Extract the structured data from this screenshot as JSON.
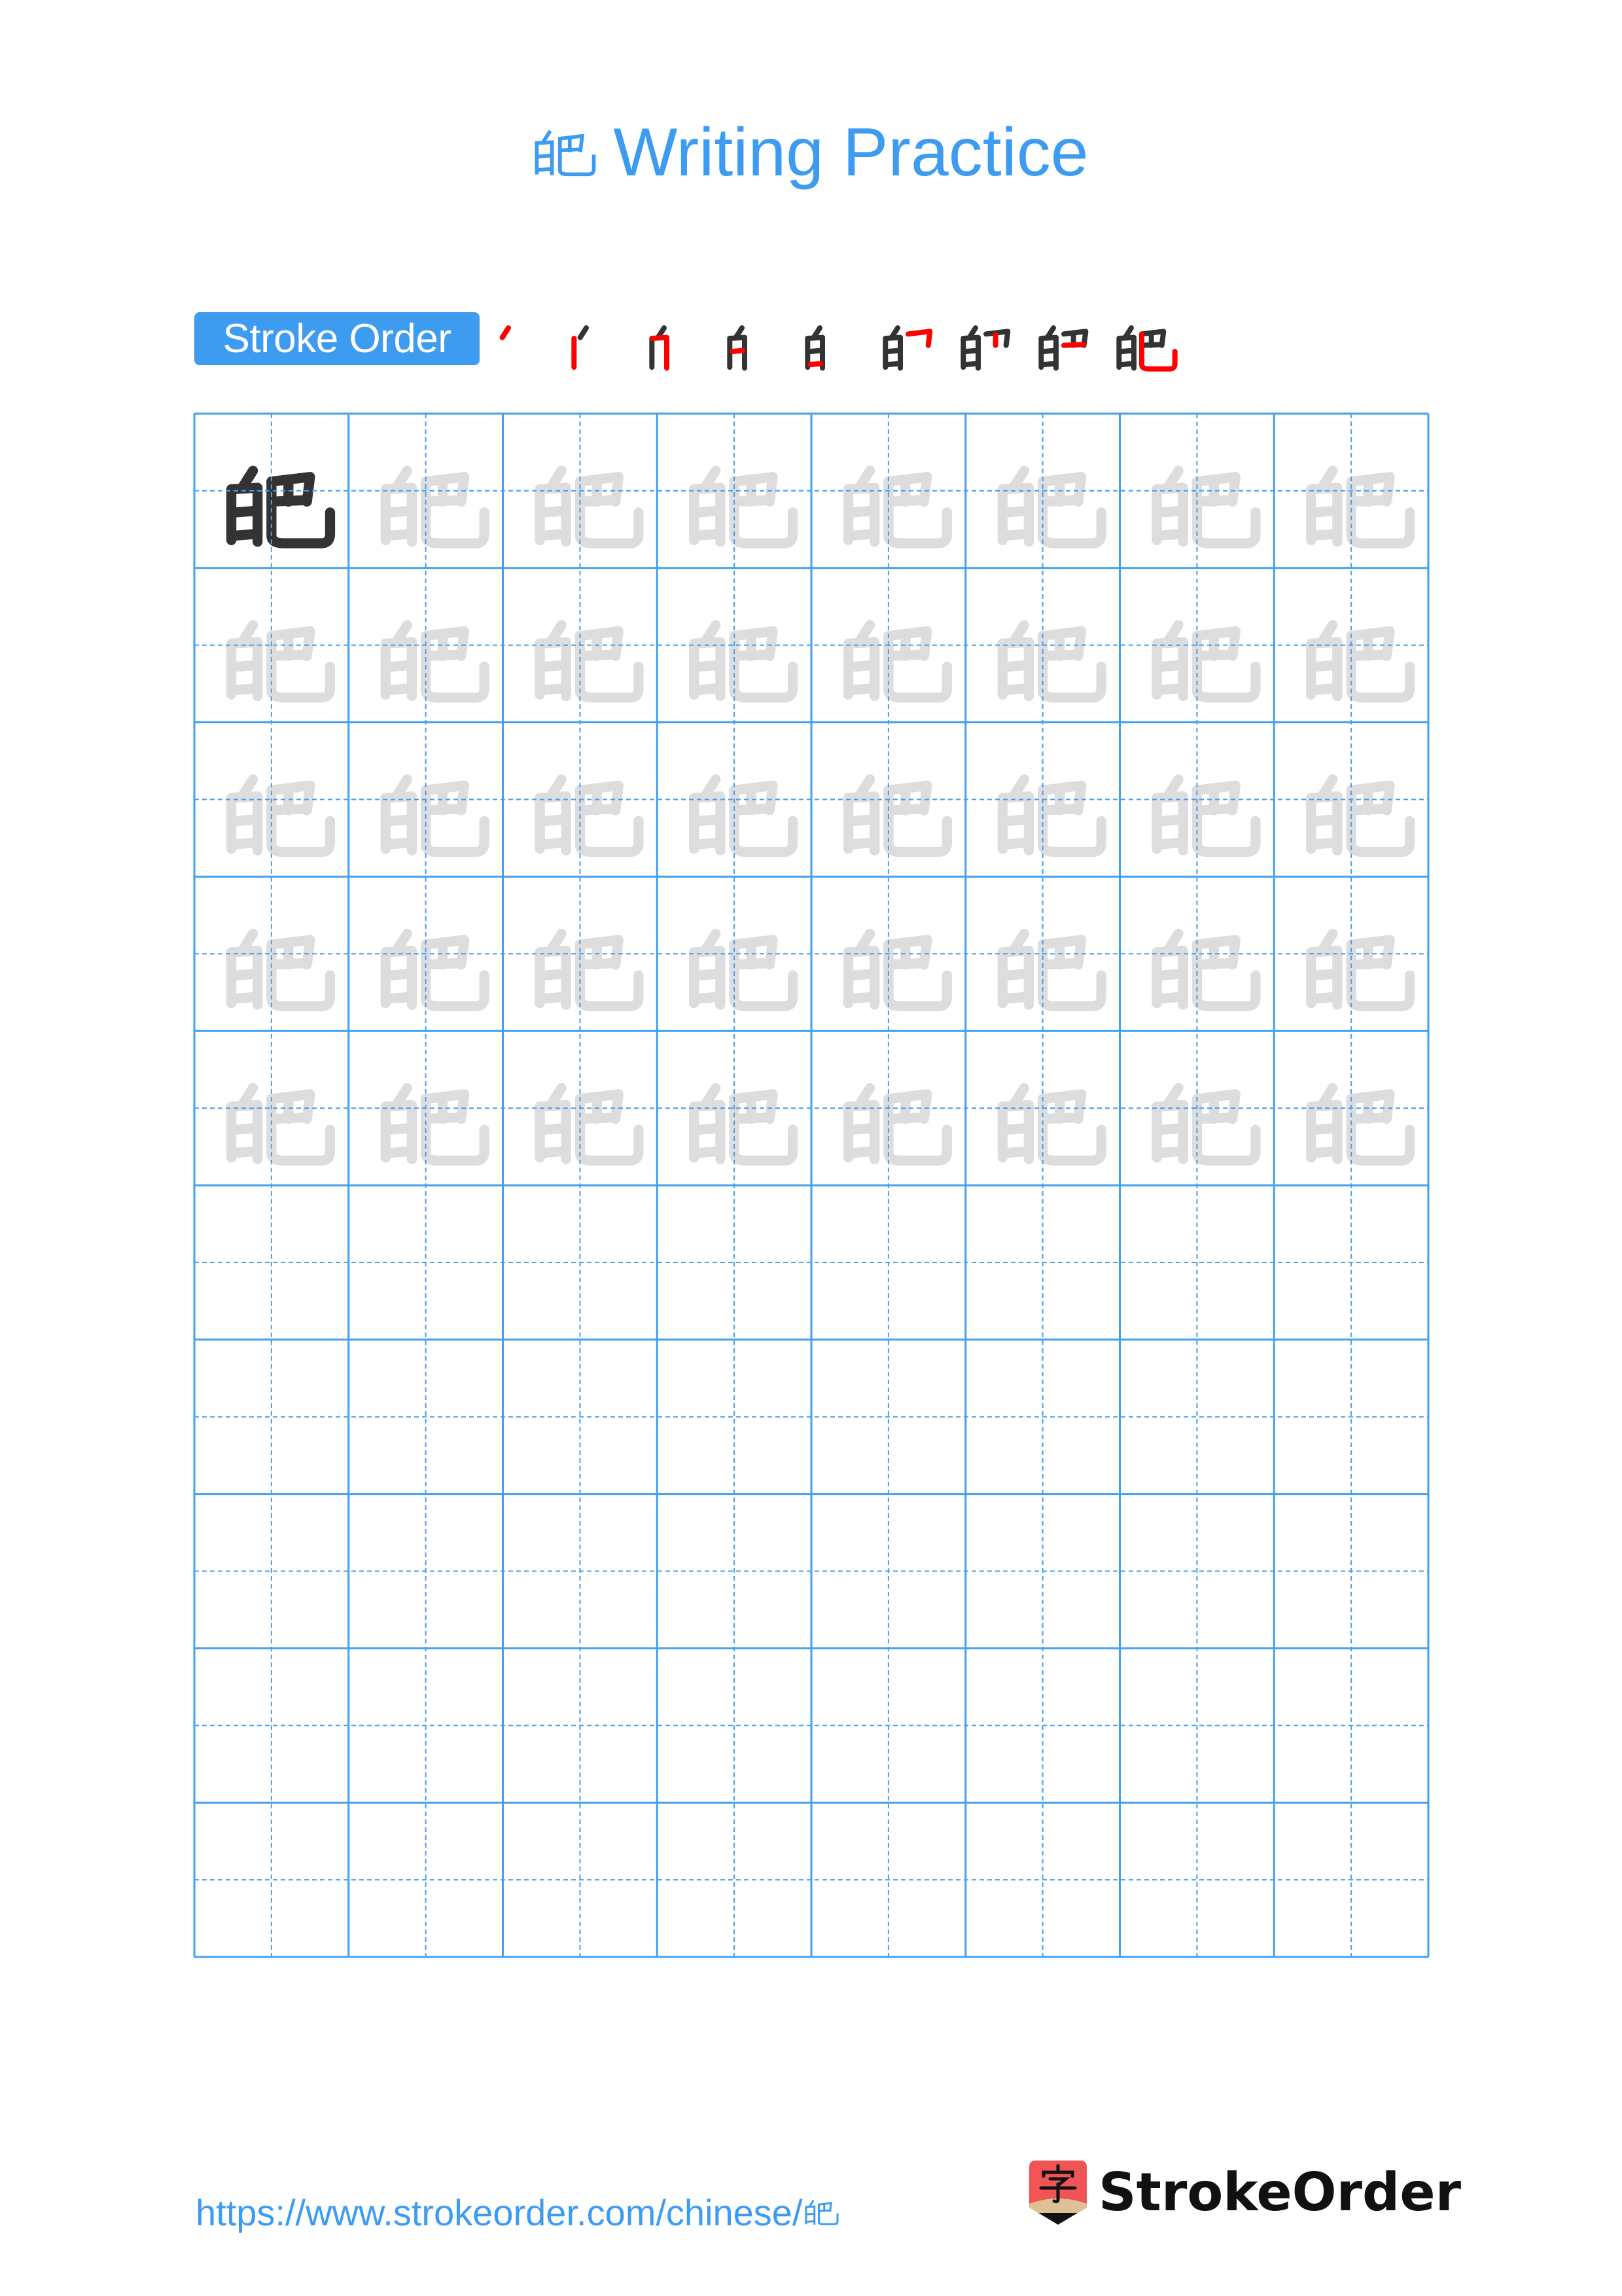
{
  "page": {
    "title_character": "皅",
    "title_suffix": "Writing Practice"
  },
  "stroke_order": {
    "badge_label": "Stroke Order",
    "total_strokes": 9,
    "frames": [
      1,
      2,
      3,
      4,
      5,
      6,
      7,
      8,
      9
    ],
    "active_color": "#ff0000",
    "done_color": "#333333"
  },
  "practice_grid": {
    "columns": 8,
    "rows": 10,
    "model_character": "皅",
    "model_cells": 1,
    "trace_rows": 5,
    "blank_rows": 5,
    "line_color": "#42a0f0",
    "model_color": "#333333",
    "trace_color": "#dddddd"
  },
  "footer": {
    "url_text": "https://www.strokeorder.com/chinese/",
    "url_character": "皅",
    "logo_icon_char": "字",
    "logo_text": "StrokeOrder",
    "logo_colors": {
      "red": "#f05454",
      "tan": "#dfc095",
      "black": "#111111"
    }
  },
  "colors": {
    "accent": "#3d9bf2"
  }
}
